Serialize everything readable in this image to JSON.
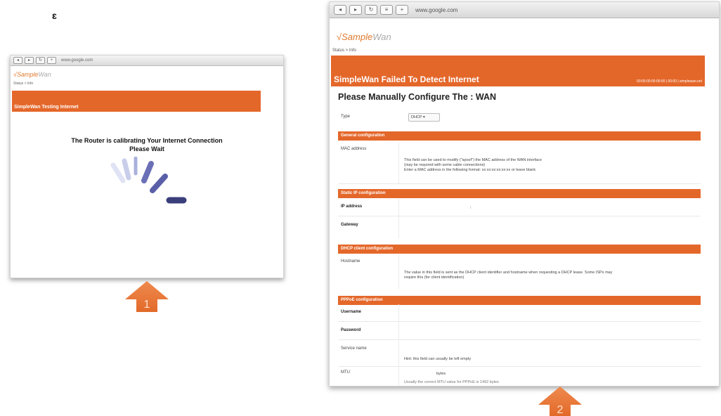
{
  "stray_mark": "ɛ",
  "screen1": {
    "url": "www.google.com",
    "logo_main": "Sample",
    "logo_suffix": "Wan",
    "breadcrumb": "Status > Info",
    "banner": "SimpleWan Testing Internet",
    "message_line1": "The Router is calibrating Your Internet Connection",
    "message_line2": "Please Wait",
    "step": "1"
  },
  "screen2": {
    "url": "www.google.com",
    "logo_main": "Sample",
    "logo_suffix": "Wan",
    "breadcrumb": "Status > Info",
    "banner_title": "SimpleWan Failed To Detect Internet",
    "banner_right": "00:00:00:00:00:00 | 00:00 | simplewan.net",
    "page_title": "Please Manually Configure The : WAN",
    "type_label": "Type",
    "type_value": "DHCP",
    "sections": {
      "general": "General configuration",
      "static": "Static IP configuration",
      "dhcp": "DHCP client configuration",
      "pppoe": "PPPoE configuration"
    },
    "general": {
      "mac_label": "MAC address",
      "mac_desc_1": "This field can be used to modify (\"spoof\") the MAC address of the WAN interface",
      "mac_desc_2": "(may be required with some cable connections)",
      "mac_desc_3": "Enter a MAC address in the following format: xx:xx:xx:xx:xx:xx or leave blank"
    },
    "static": {
      "ip_label": "IP address",
      "gateway_label": "Gateway",
      "ip_slash": "/"
    },
    "dhcp": {
      "hostname_label": "Hostname",
      "hostname_desc_1": "The value in this field is sent as the DHCP client identifier and hostname when requesting a DHCP lease. Some ISPs may",
      "hostname_desc_2": "require this (for client identification)"
    },
    "pppoe": {
      "username_label": "Username",
      "password_label": "Password",
      "service_label": "Service name",
      "service_desc": "Hint: this field can usually be left empty",
      "mtu_label": "MTU",
      "mtu_value": "bytes",
      "mtu_desc": "Usually the correct MTU value for PPPoE is 1492 bytes"
    },
    "step": "2"
  },
  "colors": {
    "accent": "#e4672a",
    "spinner_light": "#c8ceea",
    "spinner_mid": "#6a6fb6",
    "spinner_dark": "#3a3e7a"
  }
}
